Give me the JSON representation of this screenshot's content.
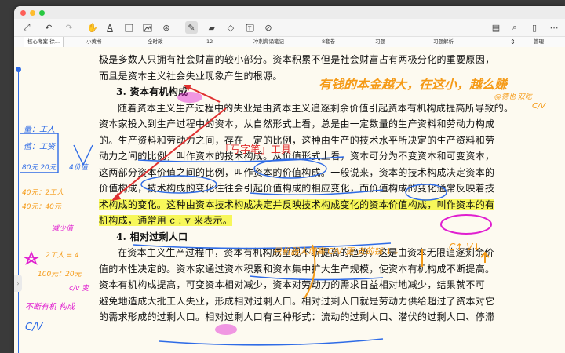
{
  "toolbar": {
    "icons": [
      "expand-icon",
      "undo-icon",
      "redo-icon",
      "hand-icon",
      "text-underline-icon",
      "rectangle-select-icon",
      "image-icon",
      "lasso-icon",
      "pen-icon",
      "highlighter-icon",
      "eraser-icon",
      "textbox-icon",
      "link-icon"
    ],
    "right_icons": [
      "document-icon",
      "search-icon",
      "page-icon",
      "more-icon"
    ]
  },
  "tabs": [
    {
      "label": "核心考案-徐..."
    },
    {
      "label": "小黄书"
    },
    {
      "label": "全时政"
    },
    {
      "label": "12"
    },
    {
      "label": "冲刺背诵笔记"
    },
    {
      "label": "8套卷"
    },
    {
      "label": "习题"
    },
    {
      "label": "习题解析"
    }
  ],
  "tabs_right": {
    "manage": "管理"
  },
  "page": {
    "lines": [
      "极是多数人只拥有社会财富的较小部分。资本积累不但是社会财富占有两极分化的重要原因，",
      "而且是资本主义社会失业现象产生的根源。",
      "随着资本主义生产过程中的失业是由资本主义追逐剩余价值引起资本有机构成提高所导致的。",
      "资本家投入到生产过程中的资本，从自然形式上看，总是由一定数量的生产资料和劳动力构成",
      "的。生产资料和劳动力之间，存在一定的比例，这种由生产的技术水平所决定的生产资料和劳",
      "动力之间的比例，叫作资本的技术构成。从价值形式上看，资本可分为不变资本和可变资本，",
      "这两部分资本价值之间的比例，叫作资本的价值构成。一般说来，资本的技术构成决定资本的",
      "价值构成，技术构成的变化往往会引起价值构成的相应变化，而价值构成的变化通常反映着技",
      "术构成的变化。这种由资本技术构成决定并反映技术构成变化的资本价值构成，叫作资本的有",
      "在资本主义生产过程中，资本有机构成呈现不断提高的趋势，这是由资本无限追逐剩余价",
      "值的本性决定的。资本家通过资本积累和资本集中扩大生产规模，使资本有机构成不断提高。",
      "资本有机构成提高，可变资本相对减少，资本对劳动力的需求日益相对地减少，结果就不可",
      "避免地造成大批工人失业，形成相对过剩人口。相对过剩人口就是劳动力供给超过了资本对它",
      "的需求形成的过剩人口。相对过剩人口有三种形式：流动的过剩人口、潜伏的过剩人口、停滞"
    ],
    "heading3": "3. 资本有机构成",
    "heading4": "4. 相对过剩人口",
    "organic_line": "机构成，通常用 c : v 来表示。"
  },
  "annotations": {
    "callout": "「写字笔」工具",
    "top_right": "有钱的本金越大，在这小，越么赚",
    "top_right_small": "@德也 双吃",
    "left_1": "量：工人",
    "left_2": "值：工资",
    "left_3": "80元 20元",
    "left_4": "4价值",
    "left_5": "40元：2工人",
    "left_6": "40元：40元",
    "left_7": "减少值",
    "left_8": "2工人 = 4",
    "left_9": "100元：20元",
    "left_10": "c/v 变",
    "left_11": "不断有机 构成",
    "left_12": "C/V",
    "mid_note": "只机器人增高 C/V 更 支的钱 ↓↓",
    "mid_note2": "C↑ V↓",
    "mid_fraction": "C/V"
  },
  "colors": {
    "ink_orange": "#f59a16",
    "ink_blue": "#2e6be6",
    "ink_magenta": "#e01fd0",
    "ink_red": "#e03030",
    "highlight_yellow": "#f7f75a",
    "highlight_magenta": "#f7a3e8"
  }
}
